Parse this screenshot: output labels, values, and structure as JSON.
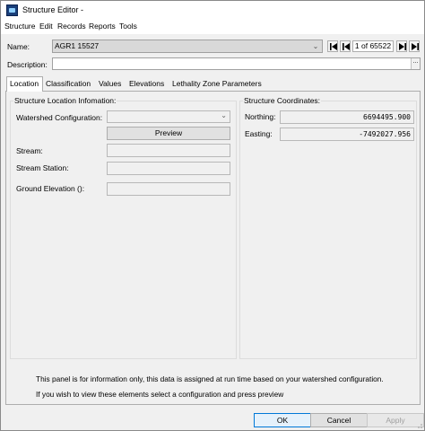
{
  "window": {
    "title": "Structure Editor -"
  },
  "menu": [
    "Structure",
    "Edit",
    "Records",
    "Reports",
    "Tools"
  ],
  "record": {
    "name_label": "Name:",
    "name_value": "AGR1 15527",
    "position_text": "1 of 65522",
    "description_label": "Description:",
    "description_value": ""
  },
  "tabs": [
    "Location",
    "Classification",
    "Values",
    "Elevations",
    "Lethality Zone Parameters"
  ],
  "active_tab": "Location",
  "location": {
    "group_title": "Structure Location Infomation:",
    "watershed_label": "Watershed Configuration:",
    "watershed_value": "",
    "preview_label": "Preview",
    "stream_label": "Stream:",
    "stream_value": "",
    "station_label": "Stream Station:",
    "station_value": "",
    "ground_label": "Ground Elevation ():",
    "ground_value": ""
  },
  "coordinates": {
    "group_title": "Structure Coordinates:",
    "northing_label": "Northing:",
    "northing_value": "6694495.900",
    "easting_label": "Easting:",
    "easting_value": "-7492027.956"
  },
  "info": {
    "line1": "This panel is for information only, this data is assigned at run time based on your watershed configuration.",
    "line2": "If you wish to view these elements select a configuration and press preview"
  },
  "buttons": {
    "ok": "OK",
    "cancel": "Cancel",
    "apply": "Apply"
  },
  "colors": {
    "focus_border": "#0078d7",
    "app_icon": "#1a3f7a"
  }
}
